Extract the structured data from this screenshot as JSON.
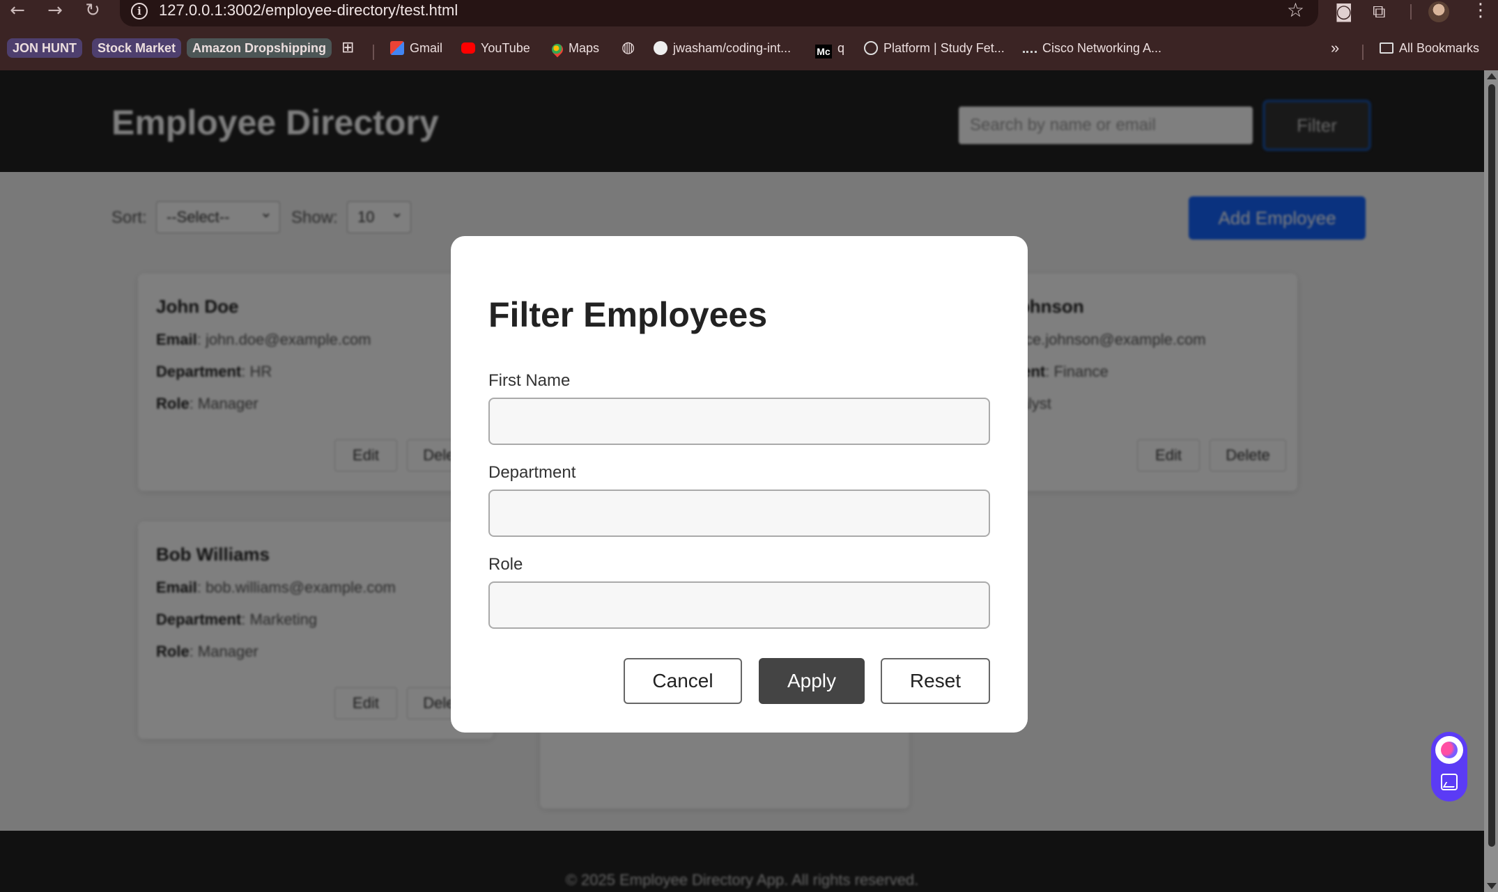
{
  "browser": {
    "url": "127.0.0.1:3002/employee-directory/test.html",
    "bookmarks": {
      "chips": [
        "JON HUNT",
        "Stock Market",
        "Amazon Dropshipping"
      ],
      "items": [
        "Gmail",
        "YouTube",
        "Maps",
        "jwasham/coding-int...",
        "q",
        "Platform | Study Fet...",
        "Cisco Networking A..."
      ],
      "overflow": "»",
      "all_bookmarks": "All Bookmarks"
    }
  },
  "site": {
    "title": "Employee Directory",
    "search_placeholder": "Search by name or email",
    "filter_label": "Filter",
    "sort_label": "Sort:",
    "sort_value": "--Select--",
    "show_label": "Show:",
    "show_value": "10",
    "add_label": "Add Employee",
    "field_labels": {
      "email": "Email",
      "department": "Department",
      "role": "Role"
    },
    "edit_label": "Edit",
    "delete_label": "Delete",
    "footer": "© 2025 Employee Directory App. All rights reserved."
  },
  "employees": [
    {
      "name": "John Doe",
      "email": "john.doe@example.com",
      "department": "HR",
      "role": "Manager"
    },
    {
      "name": "Alice Johnson",
      "email": "alice.johnson@example.com",
      "department": "Finance",
      "role": "Analyst"
    },
    {
      "name": "Bob Williams",
      "email": "bob.williams@example.com",
      "department": "Marketing",
      "role": "Manager"
    }
  ],
  "modal": {
    "title": "Filter Employees",
    "first_name_label": "First Name",
    "first_name_value": "",
    "department_label": "Department",
    "department_value": "",
    "role_label": "Role",
    "role_value": "",
    "cancel_label": "Cancel",
    "apply_label": "Apply",
    "reset_label": "Reset"
  },
  "colors": {
    "chrome_bg": "#3b2424",
    "header_bg": "#222222",
    "accent_blue": "#1464ff",
    "apply_bg": "#444444",
    "widget_bg": "#5b3bf5"
  }
}
